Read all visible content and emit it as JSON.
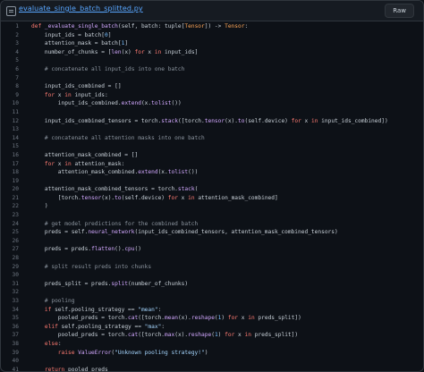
{
  "header": {
    "file_name": "evaluate_single_batch_splitted.py",
    "raw_label": "Raw"
  },
  "code_lines": [
    [
      [
        "kw",
        "def "
      ],
      [
        "fn",
        "_evaluate_single_batch"
      ],
      [
        "",
        "(self, batch: tuple["
      ],
      [
        "ty",
        "Tensor"
      ],
      [
        "",
        "]) -> "
      ],
      [
        "ty",
        "Tensor"
      ],
      [
        "",
        ":"
      ]
    ],
    [
      [
        "",
        "    input_ids = batch["
      ],
      [
        "num",
        "0"
      ],
      [
        "",
        "]"
      ]
    ],
    [
      [
        "",
        "    attention_mask = batch["
      ],
      [
        "num",
        "1"
      ],
      [
        "",
        "]"
      ]
    ],
    [
      [
        "",
        "    number_of_chunks = ["
      ],
      [
        "fn",
        "len"
      ],
      [
        "",
        "(x) "
      ],
      [
        "kw",
        "for"
      ],
      [
        "",
        " x "
      ],
      [
        "kw",
        "in"
      ],
      [
        "",
        " input_ids]"
      ]
    ],
    [],
    [
      [
        "cm",
        "    # concatenate all input_ids into one batch"
      ]
    ],
    [],
    [
      [
        "",
        "    input_ids_combined = []"
      ]
    ],
    [
      [
        "kw",
        "    for"
      ],
      [
        "",
        " x "
      ],
      [
        "kw",
        "in"
      ],
      [
        "",
        " input_ids:"
      ]
    ],
    [
      [
        "",
        "        input_ids_combined."
      ],
      [
        "fn",
        "extend"
      ],
      [
        "",
        "(x."
      ],
      [
        "fn",
        "tolist"
      ],
      [
        "",
        "())"
      ]
    ],
    [],
    [
      [
        "",
        "    input_ids_combined_tensors = torch."
      ],
      [
        "fn",
        "stack"
      ],
      [
        "",
        "([torch."
      ],
      [
        "fn",
        "tensor"
      ],
      [
        "",
        "(x)."
      ],
      [
        "fn",
        "to"
      ],
      [
        "",
        "(self.device) "
      ],
      [
        "kw",
        "for"
      ],
      [
        "",
        " x "
      ],
      [
        "kw",
        "in"
      ],
      [
        "",
        " input_ids_combined])"
      ]
    ],
    [],
    [
      [
        "cm",
        "    # concatenate all attention masks into one batch"
      ]
    ],
    [],
    [
      [
        "",
        "    attention_mask_combined = []"
      ]
    ],
    [
      [
        "kw",
        "    for"
      ],
      [
        "",
        " x "
      ],
      [
        "kw",
        "in"
      ],
      [
        "",
        " attention_mask:"
      ]
    ],
    [
      [
        "",
        "        attention_mask_combined."
      ],
      [
        "fn",
        "extend"
      ],
      [
        "",
        "(x."
      ],
      [
        "fn",
        "tolist"
      ],
      [
        "",
        "())"
      ]
    ],
    [],
    [
      [
        "",
        "    attention_mask_combined_tensors = torch."
      ],
      [
        "fn",
        "stack"
      ],
      [
        "",
        "("
      ]
    ],
    [
      [
        "",
        "        [torch."
      ],
      [
        "fn",
        "tensor"
      ],
      [
        "",
        "(x)."
      ],
      [
        "fn",
        "to"
      ],
      [
        "",
        "(self.device) "
      ],
      [
        "kw",
        "for"
      ],
      [
        "",
        " x "
      ],
      [
        "kw",
        "in"
      ],
      [
        "",
        " attention_mask_combined]"
      ]
    ],
    [
      [
        "",
        "    )"
      ]
    ],
    [],
    [
      [
        "cm",
        "    # get model predictions for the combined batch"
      ]
    ],
    [
      [
        "",
        "    preds = self."
      ],
      [
        "fn",
        "neural_network"
      ],
      [
        "",
        "(input_ids_combined_tensors, attention_mask_combined_tensors)"
      ]
    ],
    [],
    [
      [
        "",
        "    preds = preds."
      ],
      [
        "fn",
        "flatten"
      ],
      [
        "",
        "()."
      ],
      [
        "fn",
        "cpu"
      ],
      [
        "",
        "()"
      ]
    ],
    [],
    [
      [
        "cm",
        "    # split result preds into chunks"
      ]
    ],
    [],
    [
      [
        "",
        "    preds_split = preds."
      ],
      [
        "fn",
        "split"
      ],
      [
        "",
        "(number_of_chunks)"
      ]
    ],
    [],
    [
      [
        "cm",
        "    # pooling"
      ]
    ],
    [
      [
        "kw",
        "    if"
      ],
      [
        "",
        " self.pooling_strategy == "
      ],
      [
        "str",
        "\"mean\""
      ],
      [
        "",
        ":"
      ]
    ],
    [
      [
        "",
        "        pooled_preds = torch."
      ],
      [
        "fn",
        "cat"
      ],
      [
        "",
        "([torch."
      ],
      [
        "fn",
        "mean"
      ],
      [
        "",
        "(x)."
      ],
      [
        "fn",
        "reshape"
      ],
      [
        "",
        "("
      ],
      [
        "num",
        "1"
      ],
      [
        "",
        ") "
      ],
      [
        "kw",
        "for"
      ],
      [
        "",
        " x "
      ],
      [
        "kw",
        "in"
      ],
      [
        "",
        " preds_split])"
      ]
    ],
    [
      [
        "kw",
        "    elif"
      ],
      [
        "",
        " self.pooling_strategy == "
      ],
      [
        "str",
        "\"max\""
      ],
      [
        "",
        ":"
      ]
    ],
    [
      [
        "",
        "        pooled_preds = torch."
      ],
      [
        "fn",
        "cat"
      ],
      [
        "",
        "([torch."
      ],
      [
        "fn",
        "max"
      ],
      [
        "",
        "(x)."
      ],
      [
        "fn",
        "reshape"
      ],
      [
        "",
        "("
      ],
      [
        "num",
        "1"
      ],
      [
        "",
        ") "
      ],
      [
        "kw",
        "for"
      ],
      [
        "",
        " x "
      ],
      [
        "kw",
        "in"
      ],
      [
        "",
        " preds_split])"
      ]
    ],
    [
      [
        "kw",
        "    else"
      ],
      [
        "",
        ":"
      ]
    ],
    [
      [
        "kw",
        "        raise "
      ],
      [
        "fn",
        "ValueError"
      ],
      [
        "",
        "("
      ],
      [
        "str",
        "\"Unknown pooling strategy!\""
      ],
      [
        "",
        ")"
      ]
    ],
    [],
    [
      [
        "kw",
        "    return"
      ],
      [
        "",
        " pooled_preds"
      ]
    ]
  ]
}
